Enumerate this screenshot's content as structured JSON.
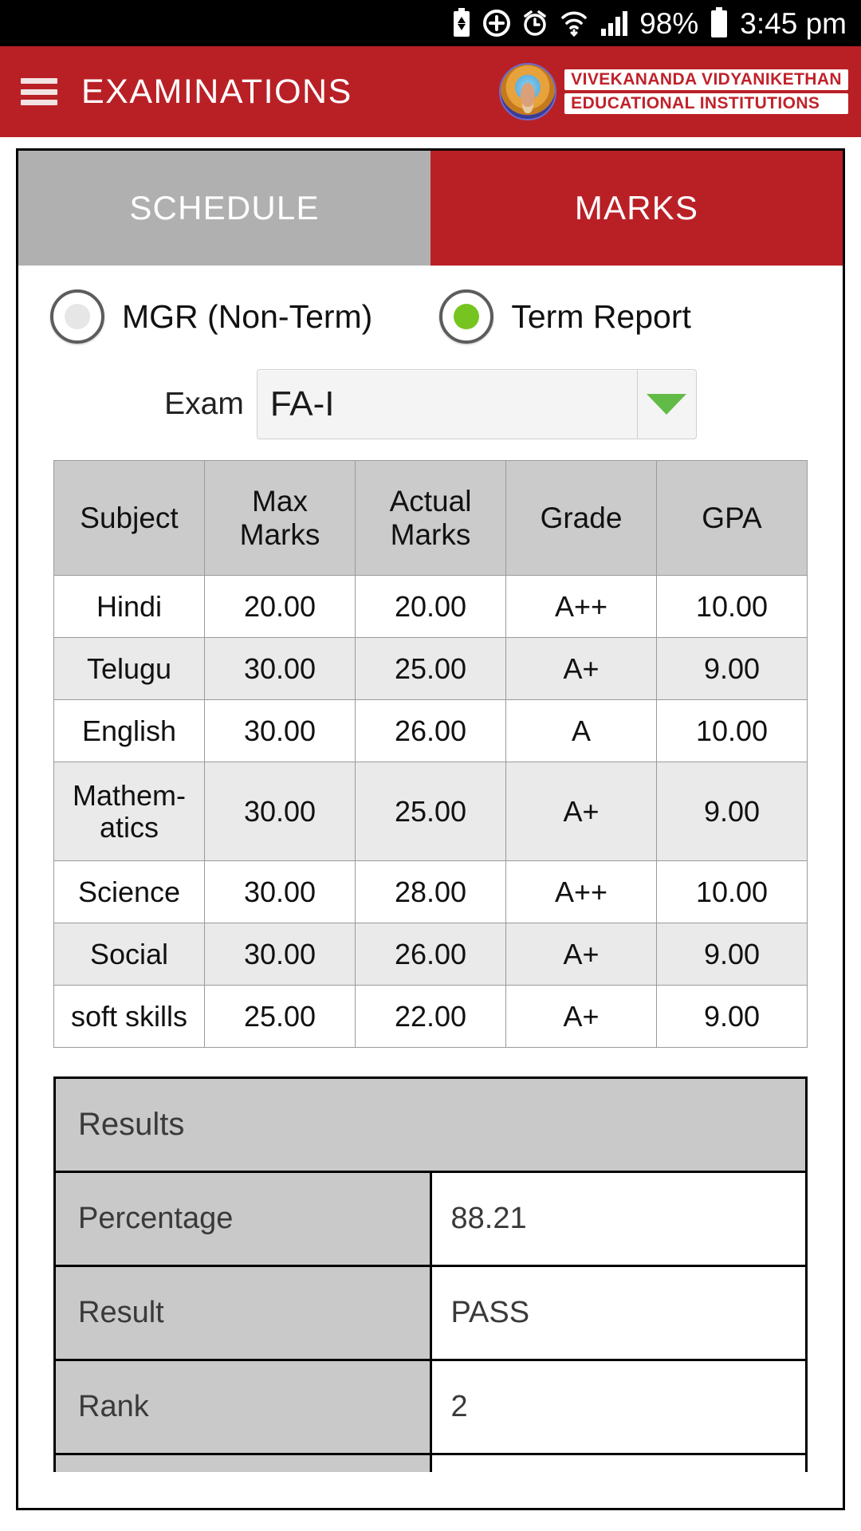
{
  "statusbar": {
    "icons": [
      "battery-saver-icon",
      "add-circle-icon",
      "alarm-icon",
      "wifi-icon",
      "signal-icon"
    ],
    "battery_percent": "98%",
    "time": "3:45 pm"
  },
  "appbar": {
    "menu_icon": "hamburger-menu-icon",
    "title": "EXAMINATIONS",
    "brand": {
      "line1": "VIVEKANANDA VIDYANIKETHAN",
      "line2": "EDUCATIONAL INSTITUTIONS"
    }
  },
  "tabs": [
    {
      "label": "SCHEDULE",
      "active": false
    },
    {
      "label": "MARKS",
      "active": true
    }
  ],
  "report_type": {
    "options": [
      {
        "label": "MGR (Non-Term)",
        "selected": false
      },
      {
        "label": "Term Report",
        "selected": true
      }
    ]
  },
  "exam_select": {
    "label": "Exam",
    "value": "FA-I",
    "arrow_icon": "caret-down-icon"
  },
  "marks_table": {
    "headers": [
      "Subject",
      "Max\nMarks",
      "Actual\nMarks",
      "Grade",
      "GPA"
    ],
    "header_subject": "Subject",
    "header_max_line1": "Max",
    "header_max_line2": "Marks",
    "header_actual_line1": "Actual",
    "header_actual_line2": "Marks",
    "header_grade": "Grade",
    "header_gpa": "GPA",
    "rows": [
      {
        "subject": "Hindi",
        "max": "20.00",
        "actual": "20.00",
        "grade": "A++",
        "gpa": "10.00"
      },
      {
        "subject": "Telugu",
        "max": "30.00",
        "actual": "25.00",
        "grade": "A+",
        "gpa": "9.00"
      },
      {
        "subject": "English",
        "max": "30.00",
        "actual": "26.00",
        "grade": "A",
        "gpa": "10.00"
      },
      {
        "subject": "Mathem-\natics",
        "subject_line1": "Mathem-",
        "subject_line2": "atics",
        "max": "30.00",
        "actual": "25.00",
        "grade": "A+",
        "gpa": "9.00"
      },
      {
        "subject": "Science",
        "max": "30.00",
        "actual": "28.00",
        "grade": "A++",
        "gpa": "10.00"
      },
      {
        "subject": "Social",
        "max": "30.00",
        "actual": "26.00",
        "grade": "A+",
        "gpa": "9.00"
      },
      {
        "subject": "soft skills",
        "max": "25.00",
        "actual": "22.00",
        "grade": "A+",
        "gpa": "9.00"
      }
    ]
  },
  "results": {
    "title": "Results",
    "rows": [
      {
        "key": "Percentage",
        "value": "88.21"
      },
      {
        "key": "Result",
        "value": "PASS"
      },
      {
        "key": "Rank",
        "value": "2"
      }
    ]
  },
  "colors": {
    "brand_red": "#b92026",
    "tab_inactive": "#b0b0b0",
    "accent_green": "#76c41f",
    "caret_green": "#62bb46",
    "header_gray": "#cbcbcb",
    "results_gray": "#c9c9c9"
  }
}
